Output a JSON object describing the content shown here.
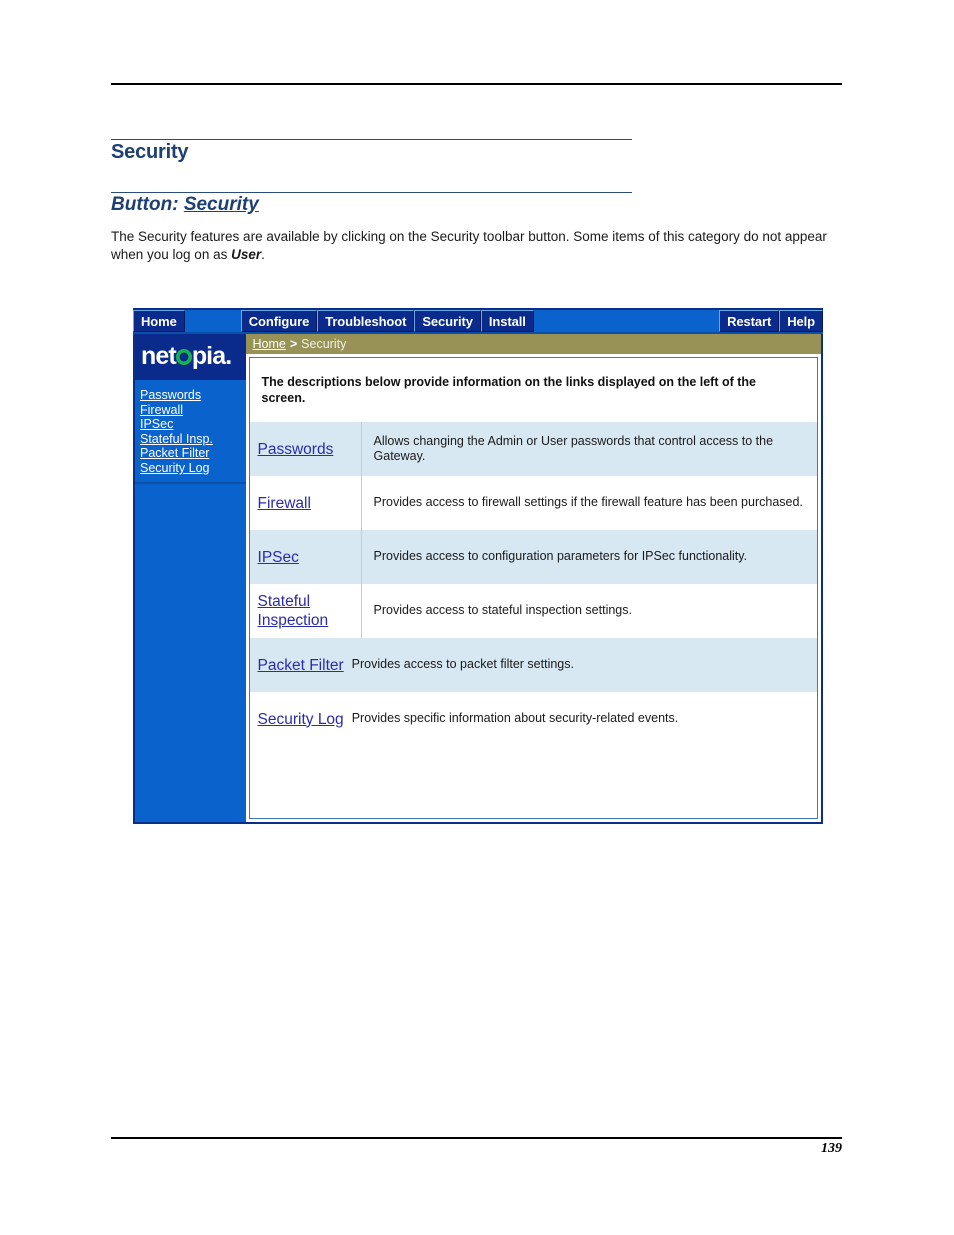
{
  "document": {
    "page_number": "139",
    "heading": "Security",
    "subheading_prefix": "Button: ",
    "subheading_link": "Security",
    "paragraph_part1": "The Security features are available by clicking on the Security toolbar button. Some items of this category do not appear when you log on as ",
    "paragraph_emphasis": "User",
    "paragraph_part2": "."
  },
  "screenshot": {
    "toolbar": {
      "home": "Home",
      "configure": "Configure",
      "troubleshoot": "Troubleshoot",
      "security": "Security",
      "install": "Install",
      "restart": "Restart",
      "help": "Help"
    },
    "sidebar": {
      "logo_before": "net",
      "logo_after": "pia",
      "logo_dot": ".",
      "links": [
        "Passwords",
        "Firewall",
        "IPSec",
        "Stateful Insp.",
        "Packet Filter",
        "Security Log"
      ]
    },
    "breadcrumb": {
      "home": "Home",
      "separator": ">",
      "current": "Security"
    },
    "panel": {
      "intro": "The descriptions below provide information on the links displayed on the left of the screen.",
      "rows": [
        {
          "link": "Passwords",
          "description": "Allows changing the Admin or User passwords that control access to the Gateway."
        },
        {
          "link": "Firewall",
          "description": "Provides access to firewall settings if the firewall feature has been purchased."
        },
        {
          "link": "IPSec",
          "description": "Provides access to configuration parameters for IPSec functionality."
        },
        {
          "link": "Stateful Inspection",
          "description": "Provides access to stateful inspection settings."
        },
        {
          "link": "Packet Filter",
          "description": "Provides access to packet filter settings."
        },
        {
          "link": "Security Log",
          "description": "Provides specific information about security-related events."
        }
      ]
    }
  },
  "colors": {
    "heading_blue": "#1d3f72",
    "toolbar_bg": "#0a62cc",
    "toolbar_button": "#0a2a8c",
    "breadcrumb_bg": "#989257",
    "row_alt_bg": "#d8e8f3",
    "link_blue": "#2b2bb0",
    "logo_green": "#17b24a"
  }
}
